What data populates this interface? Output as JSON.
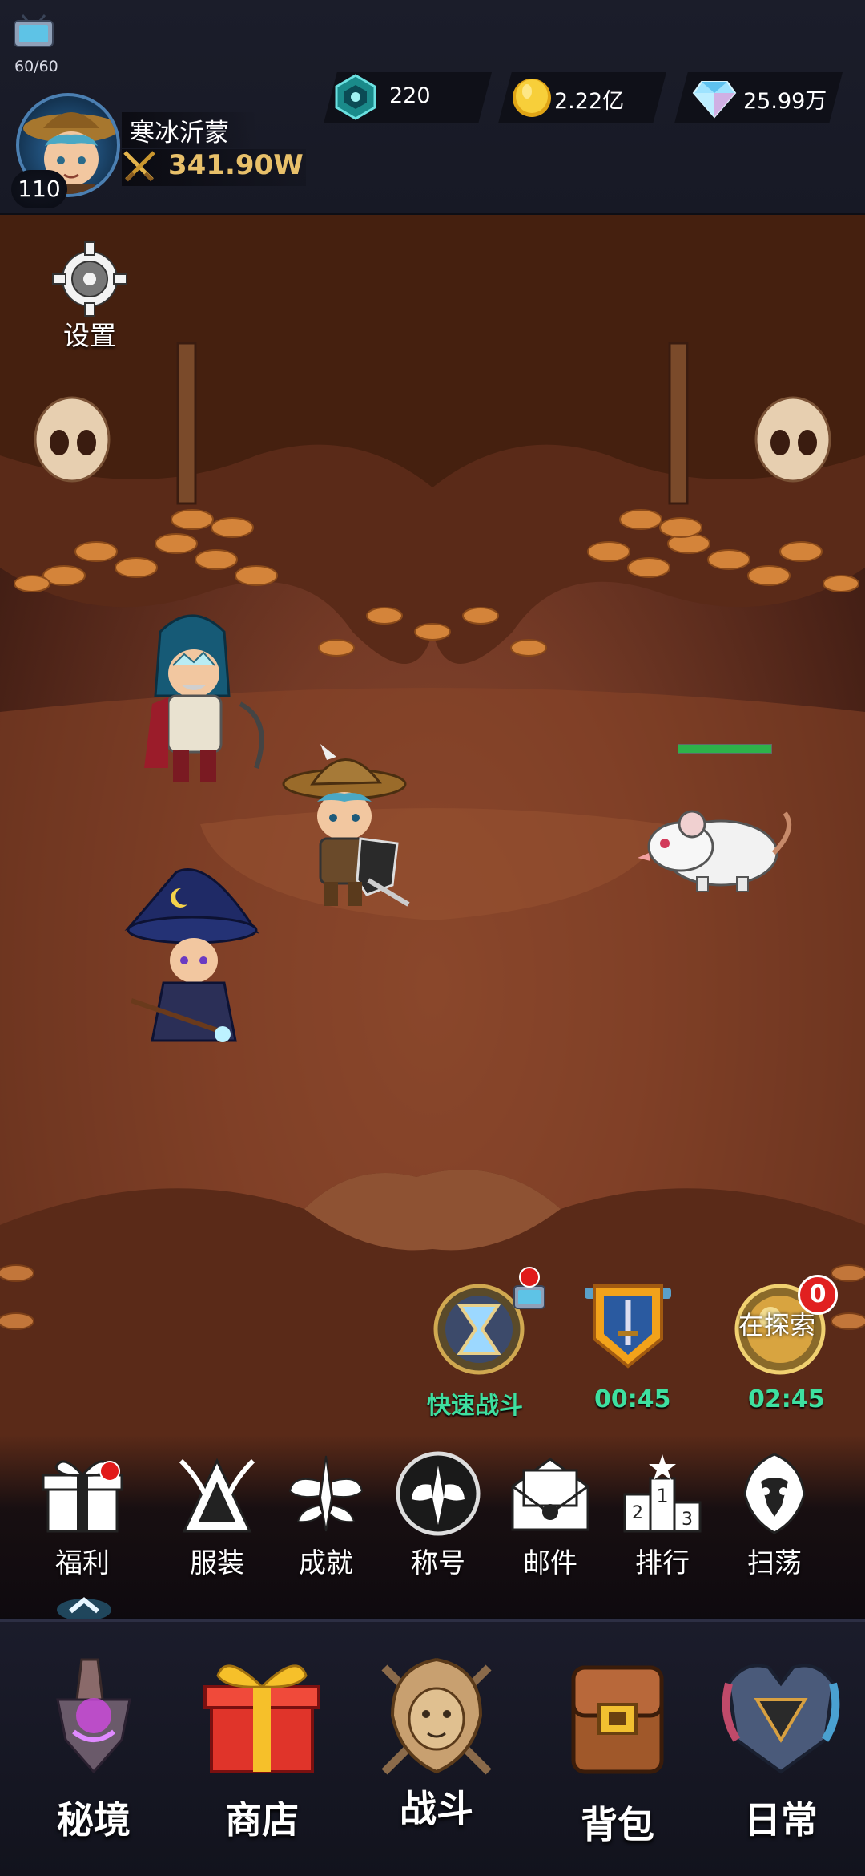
{
  "header": {
    "stamina": "60/60",
    "level": "110",
    "player_name": "寒冰沂蒙",
    "power": "341.90W",
    "resources": [
      {
        "icon": "gem-token-icon",
        "value": "220"
      },
      {
        "icon": "gold-coin-icon",
        "value": "2.22亿"
      },
      {
        "icon": "diamond-icon",
        "value": "25.99万"
      }
    ]
  },
  "scene": {
    "settings_label": "设置",
    "enemy_hp_fraction": 1.0,
    "quick_actions": [
      {
        "icon": "quick-battle-icon",
        "label": "快速战斗"
      },
      {
        "icon": "sword-shield-icon",
        "label": "00:45"
      },
      {
        "icon": "explore-orb-icon",
        "label": "02:45",
        "badge": "0",
        "overlay_text": "在探索"
      }
    ]
  },
  "functions": [
    {
      "icon": "gift-icon",
      "label": "福利"
    },
    {
      "icon": "costume-icon",
      "label": "服装"
    },
    {
      "icon": "achievement-icon",
      "label": "成就"
    },
    {
      "icon": "title-icon",
      "label": "称号"
    },
    {
      "icon": "mail-icon",
      "label": "邮件"
    },
    {
      "icon": "ranking-icon",
      "label": "排行"
    },
    {
      "icon": "sweep-icon",
      "label": "扫荡"
    }
  ],
  "bottom_nav": [
    {
      "icon": "secret-realm-icon",
      "label": "秘境"
    },
    {
      "icon": "shop-gift-icon",
      "label": "商店"
    },
    {
      "icon": "battle-lion-icon",
      "label": "战斗"
    },
    {
      "icon": "backpack-icon",
      "label": "背包"
    },
    {
      "icon": "daily-icon",
      "label": "日常"
    }
  ]
}
